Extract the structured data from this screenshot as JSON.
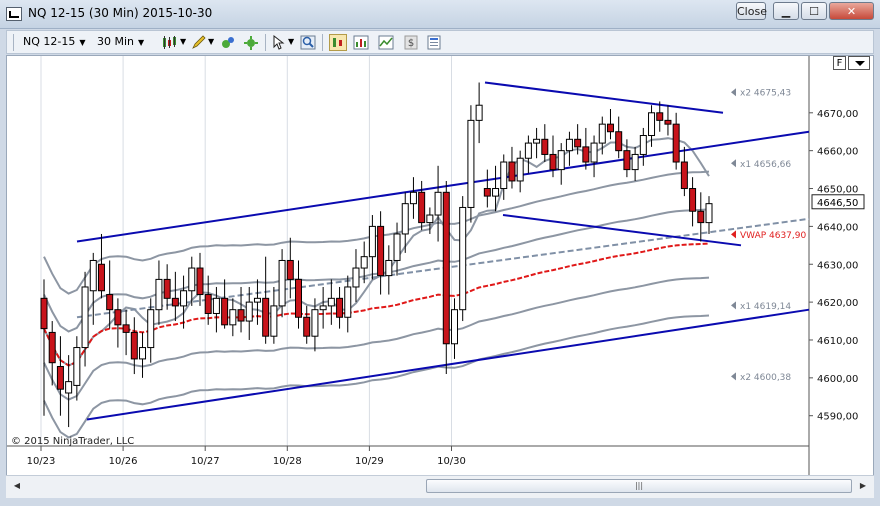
{
  "window": {
    "title": "NQ 12-15 (30 Min)  2015-10-30",
    "btn_restore": "Close"
  },
  "toolbar": {
    "instrument": "NQ 12-15",
    "interval": "30 Min"
  },
  "chart_panel": {
    "f_button": "F",
    "copyright": "© 2015 NinjaTrader, LLC",
    "scroll_grip": "|||"
  },
  "chart_data": {
    "type": "candlestick",
    "ylim": [
      4582,
      4685
    ],
    "y_ticks": [
      "4670,00",
      "4660,00",
      "4650,00",
      "4640,00",
      "4630,00",
      "4620,00",
      "4610,00",
      "4600,00",
      "4590,00"
    ],
    "y_tick_values": [
      4670,
      4660,
      4650,
      4640,
      4630,
      4620,
      4610,
      4600,
      4590
    ],
    "x_labels": [
      "10/23",
      "10/26",
      "10/27",
      "10/28",
      "10/29",
      "10/30"
    ],
    "last_price": "4646,50",
    "last_price_value": 4646.5,
    "annotations": [
      {
        "text": "x2  4675,43",
        "price": 4675.43,
        "color": "#7f8896"
      },
      {
        "text": "x1  4656,66",
        "price": 4656.66,
        "color": "#7f8896"
      },
      {
        "text": "VWAP  4637,90",
        "price": 4637.9,
        "color": "#e02020"
      },
      {
        "text": "x1  4619,14",
        "price": 4619.14,
        "color": "#7f8896"
      },
      {
        "text": "x2  4600,38",
        "price": 4600.38,
        "color": "#7f8896"
      }
    ],
    "candles": [
      [
        4621,
        4626,
        4590,
        4613
      ],
      [
        4612,
        4615,
        4598,
        4604
      ],
      [
        4603,
        4611,
        4590,
        4597
      ],
      [
        4596,
        4606,
        4587,
        4599
      ],
      [
        4598,
        4611,
        4594,
        4608
      ],
      [
        4608,
        4628,
        4603,
        4624
      ],
      [
        4623,
        4633,
        4614,
        4631
      ],
      [
        4630,
        4638,
        4621,
        4623
      ],
      [
        4622,
        4631,
        4613,
        4618
      ],
      [
        4618,
        4621,
        4608,
        4614
      ],
      [
        4614,
        4618,
        4606,
        4612
      ],
      [
        4612,
        4616,
        4601,
        4605
      ],
      [
        4605,
        4612,
        4600,
        4608
      ],
      [
        4608,
        4621,
        4604,
        4618
      ],
      [
        4618,
        4631,
        4614,
        4626
      ],
      [
        4626,
        4630,
        4618,
        4621
      ],
      [
        4621,
        4628,
        4615,
        4619
      ],
      [
        4619,
        4627,
        4613,
        4623
      ],
      [
        4623,
        4632,
        4619,
        4629
      ],
      [
        4629,
        4633,
        4619,
        4622
      ],
      [
        4622,
        4627,
        4614,
        4617
      ],
      [
        4617,
        4624,
        4612,
        4621
      ],
      [
        4621,
        4626,
        4613,
        4614
      ],
      [
        4614,
        4621,
        4611,
        4618
      ],
      [
        4618,
        4624,
        4612,
        4615
      ],
      [
        4615,
        4624,
        4610,
        4620
      ],
      [
        4620,
        4626,
        4614,
        4621
      ],
      [
        4621,
        4632,
        4609,
        4611
      ],
      [
        4611,
        4624,
        4609,
        4619
      ],
      [
        4619,
        4634,
        4616,
        4631
      ],
      [
        4631,
        4637,
        4621,
        4626
      ],
      [
        4626,
        4631,
        4613,
        4616
      ],
      [
        4616,
        4619,
        4609,
        4611
      ],
      [
        4611,
        4621,
        4607,
        4618
      ],
      [
        4618,
        4624,
        4613,
        4619
      ],
      [
        4619,
        4626,
        4614,
        4621
      ],
      [
        4621,
        4624,
        4613,
        4616
      ],
      [
        4616,
        4627,
        4612,
        4624
      ],
      [
        4624,
        4634,
        4620,
        4629
      ],
      [
        4629,
        4636,
        4625,
        4632
      ],
      [
        4632,
        4643,
        4626,
        4640
      ],
      [
        4640,
        4644,
        4622,
        4627
      ],
      [
        4627,
        4635,
        4622,
        4631
      ],
      [
        4631,
        4641,
        4627,
        4638
      ],
      [
        4638,
        4649,
        4633,
        4646
      ],
      [
        4646,
        4653,
        4642,
        4649
      ],
      [
        4649,
        4652,
        4639,
        4641
      ],
      [
        4641,
        4645,
        4638,
        4643
      ],
      [
        4643,
        4656,
        4636,
        4649
      ],
      [
        4649,
        4652,
        4601,
        4609
      ],
      [
        4609,
        4621,
        4605,
        4618
      ],
      [
        4618,
        4648,
        4615,
        4645
      ],
      [
        4645,
        4672,
        4641,
        4668
      ],
      [
        4668,
        4678,
        4662,
        4672
      ],
      [
        4650,
        4655,
        4645,
        4648
      ],
      [
        4648,
        4656,
        4644,
        4650
      ],
      [
        4650,
        4659,
        4647,
        4657
      ],
      [
        4657,
        4661,
        4650,
        4652
      ],
      [
        4652,
        4660,
        4649,
        4658
      ],
      [
        4658,
        4664,
        4654,
        4662
      ],
      [
        4662,
        4666,
        4658,
        4663
      ],
      [
        4663,
        4667,
        4657,
        4659
      ],
      [
        4659,
        4664,
        4653,
        4655
      ],
      [
        4655,
        4662,
        4651,
        4660
      ],
      [
        4660,
        4665,
        4656,
        4663
      ],
      [
        4663,
        4667,
        4659,
        4661
      ],
      [
        4661,
        4666,
        4655,
        4657
      ],
      [
        4657,
        4664,
        4653,
        4662
      ],
      [
        4662,
        4669,
        4659,
        4667
      ],
      [
        4667,
        4671,
        4663,
        4665
      ],
      [
        4665,
        4669,
        4658,
        4660
      ],
      [
        4660,
        4663,
        4653,
        4655
      ],
      [
        4655,
        4661,
        4652,
        4659
      ],
      [
        4659,
        4666,
        4656,
        4664
      ],
      [
        4664,
        4672,
        4661,
        4670
      ],
      [
        4670,
        4673,
        4665,
        4668
      ],
      [
        4668,
        4672,
        4664,
        4667
      ],
      [
        4667,
        4670,
        4655,
        4657
      ],
      [
        4657,
        4661,
        4648,
        4650
      ],
      [
        4650,
        4653,
        4640,
        4644
      ],
      [
        4644,
        4649,
        4636,
        4641
      ],
      [
        4641,
        4648,
        4638,
        4646
      ]
    ]
  }
}
